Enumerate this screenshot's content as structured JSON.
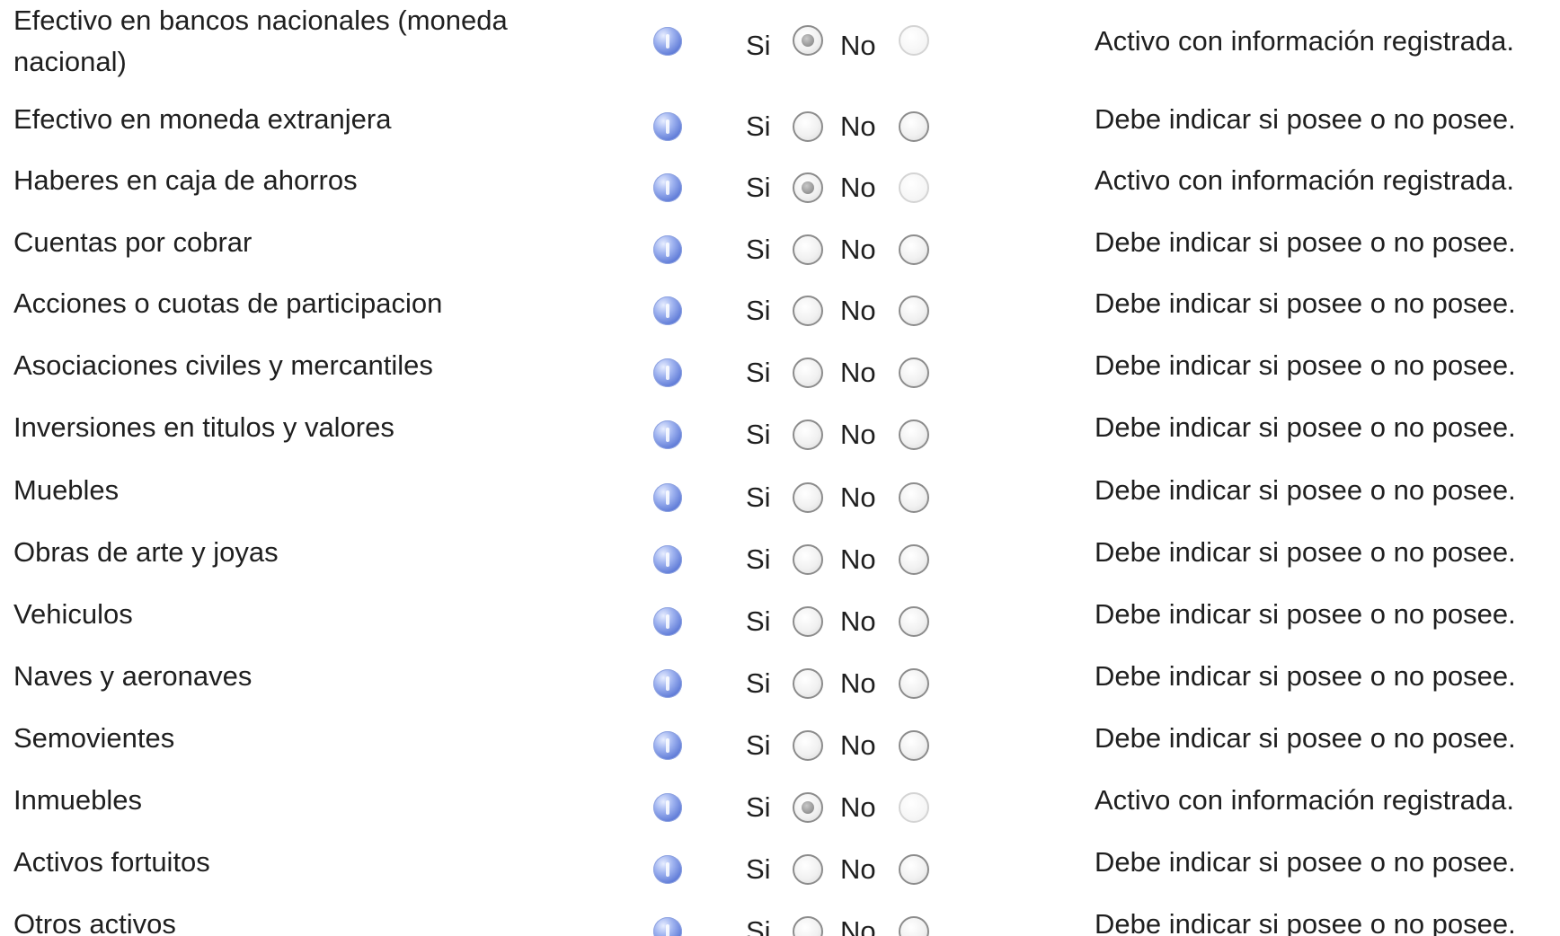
{
  "form": {
    "si_label": "Si",
    "no_label": "No",
    "rows": [
      {
        "label": "Efectivo en bancos nacionales (moneda nacional)",
        "selected": "si",
        "status": "Activo con información registrada."
      },
      {
        "label": "Efectivo en moneda extranjera",
        "selected": "none",
        "status": "Debe indicar si posee o no posee."
      },
      {
        "label": "Haberes en caja de ahorros",
        "selected": "si",
        "status": "Activo con información registrada."
      },
      {
        "label": "Cuentas por cobrar",
        "selected": "none",
        "status": "Debe indicar si posee o no posee."
      },
      {
        "label": "Acciones o cuotas de participacion",
        "selected": "none",
        "status": "Debe indicar si posee o no posee."
      },
      {
        "label": "Asociaciones civiles y mercantiles",
        "selected": "none",
        "status": "Debe indicar si posee o no posee."
      },
      {
        "label": "Inversiones en titulos y valores",
        "selected": "none",
        "status": "Debe indicar si posee o no posee."
      },
      {
        "label": "Muebles",
        "selected": "none",
        "status": "Debe indicar si posee o no posee."
      },
      {
        "label": "Obras de arte y joyas",
        "selected": "none",
        "status": "Debe indicar si posee o no posee."
      },
      {
        "label": "Vehiculos",
        "selected": "none",
        "status": "Debe indicar si posee o no posee."
      },
      {
        "label": "Naves y aeronaves",
        "selected": "none",
        "status": "Debe indicar si posee o no posee."
      },
      {
        "label": "Semovientes",
        "selected": "none",
        "status": "Debe indicar si posee o no posee."
      },
      {
        "label": "Inmuebles",
        "selected": "si",
        "status": "Activo con información registrada."
      },
      {
        "label": "Activos fortuitos",
        "selected": "none",
        "status": "Debe indicar si posee o no posee."
      },
      {
        "label": "Otros activos",
        "selected": "none",
        "status": "Debe indicar si posee o no posee."
      }
    ]
  },
  "icons": {
    "info": "info-icon"
  }
}
